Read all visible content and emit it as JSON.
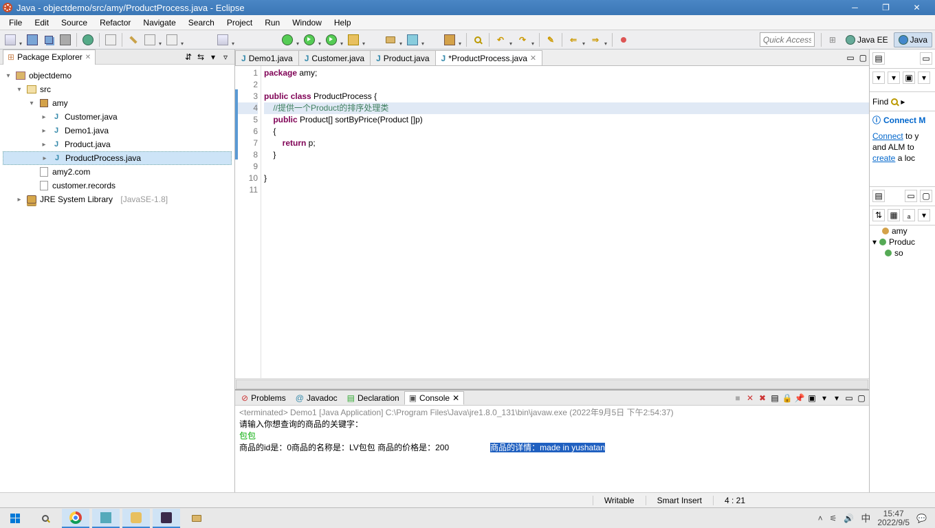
{
  "titlebar": {
    "title": "Java - objectdemo/src/amy/ProductProcess.java - Eclipse"
  },
  "menu": [
    "File",
    "Edit",
    "Source",
    "Refactor",
    "Navigate",
    "Search",
    "Project",
    "Run",
    "Window",
    "Help"
  ],
  "quick_access": "Quick Access",
  "perspectives": {
    "javaee": "Java EE",
    "java": "Java"
  },
  "package_explorer": {
    "title": "Package Explorer",
    "tree": {
      "project": "objectdemo",
      "src": "src",
      "pkg": "amy",
      "files": [
        "Customer.java",
        "Demo1.java",
        "Product.java",
        "ProductProcess.java"
      ],
      "extra": [
        "amy2.com",
        "customer.records"
      ],
      "jre": "JRE System Library",
      "jre_suffix": "[JavaSE-1.8]"
    }
  },
  "editor": {
    "tabs": [
      "Demo1.java",
      "Customer.java",
      "Product.java",
      "*ProductProcess.java"
    ],
    "active_tab": 3,
    "lines": [
      {
        "n": 1,
        "html": "<span class='kw'>package</span> amy;"
      },
      {
        "n": 2,
        "html": ""
      },
      {
        "n": 3,
        "html": "<span class='kw'>public</span> <span class='kw'>class</span> ProductProcess {"
      },
      {
        "n": 4,
        "html": "    <span class='cm'>//提供一个Product的排序处理类</span>",
        "hl": true
      },
      {
        "n": 5,
        "html": "    <span class='kw'>public</span> Product[] sortByPrice(Product []p)"
      },
      {
        "n": 6,
        "html": "    {"
      },
      {
        "n": 7,
        "html": "        <span class='kw'>return</span> p;"
      },
      {
        "n": 8,
        "html": "    }"
      },
      {
        "n": 9,
        "html": ""
      },
      {
        "n": 10,
        "html": "}"
      },
      {
        "n": 11,
        "html": ""
      }
    ]
  },
  "bottom": {
    "tabs": [
      "Problems",
      "Javadoc",
      "Declaration",
      "Console"
    ],
    "active": 3,
    "terminated": "<terminated> Demo1 [Java Application] C:\\Program Files\\Java\\jre1.8.0_131\\bin\\javaw.exe (2022年9月5日 下午2:54:37)",
    "line1": "请输入你想查询的商品的关键字：",
    "line2": "包包",
    "line3a": "商品的id是：0商品的名称是：LV包包 商品的价格是：200",
    "line3b": "商品的详情：made in yushatan"
  },
  "right": {
    "find": "Find",
    "connect_title": "Connect M",
    "connect_link": "Connect",
    "connect_t1": " to y",
    "connect_t2": "and ALM to",
    "create_link": "create",
    "connect_t3": " a loc",
    "outline": {
      "pkg": "amy",
      "cls": "Produc",
      "mth": "so"
    }
  },
  "status": {
    "writable": "Writable",
    "insert": "Smart Insert",
    "pos": "4 : 21"
  },
  "tray": {
    "ime": "中",
    "time": "15:47",
    "date": "2022/9/5"
  }
}
